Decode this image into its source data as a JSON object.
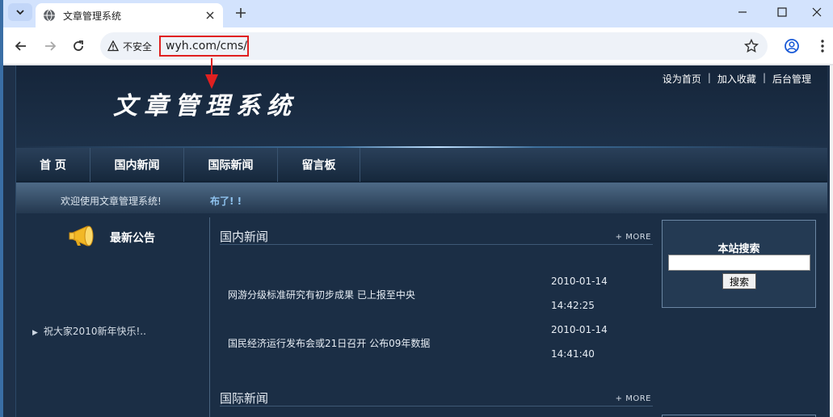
{
  "browser": {
    "tab": {
      "title": "文章管理系统"
    },
    "address_bar": {
      "security_label": "不安全",
      "url": "wyh.com/cms/"
    }
  },
  "site": {
    "top_links": [
      "设为首页",
      "加入收藏",
      "后台管理"
    ],
    "top_link_separator": "|",
    "logo_text": "文章管理系统",
    "nav": [
      "首 页",
      "国内新闻",
      "国际新闻",
      "留言板"
    ],
    "welcome": "欢迎使用文章管理系统!",
    "marquee": "布了! !",
    "notice": {
      "title": "最新公告",
      "items": [
        "祝大家2010新年快乐!.."
      ]
    },
    "sections": {
      "domestic": {
        "title": "国内新闻",
        "more": "+ MORE",
        "items": [
          {
            "title": "网游分级标准研究有初步成果 已上报至中央",
            "date": "2010-01-14",
            "time": "14:42:25"
          },
          {
            "title": "国民经济运行发布会或21日召开 公布09年数据",
            "date": "2010-01-14",
            "time": "14:41:40"
          }
        ]
      },
      "international": {
        "title": "国际新闻",
        "more": "+ MORE"
      }
    },
    "search": {
      "title": "本站搜索",
      "input_value": "",
      "button_label": "搜索"
    }
  },
  "colors": {
    "page_background": "#1e3048",
    "annotation_red": "#e02020",
    "marquee_text": "#8fc3ef"
  },
  "icons": [
    "globe-icon",
    "close-icon",
    "plus-icon",
    "back-arrow-icon",
    "forward-arrow-icon",
    "reload-icon",
    "warning-icon",
    "star-icon",
    "profile-icon",
    "kebab-menu-icon",
    "megaphone-icon"
  ]
}
